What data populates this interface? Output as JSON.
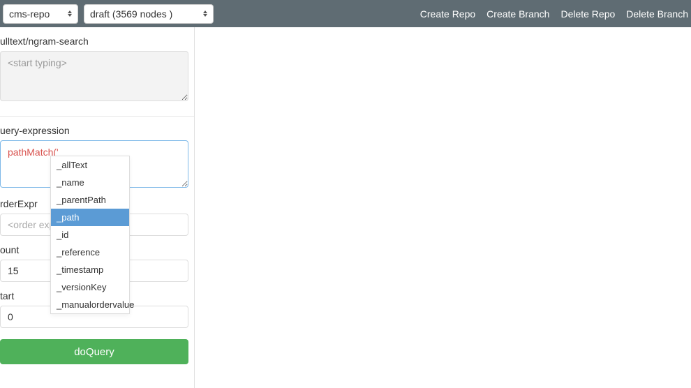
{
  "topbar": {
    "repo_select": "cms-repo",
    "branch_select": "draft (3569 nodes )",
    "actions": {
      "create_repo": "Create Repo",
      "create_branch": "Create Branch",
      "delete_repo": "Delete Repo",
      "delete_branch": "Delete Branch"
    }
  },
  "panel": {
    "fulltext_label": "ulltext/ngram-search",
    "fulltext_placeholder": "<start typing>",
    "query_label": "uery-expression",
    "query_value": "pathMatch('_",
    "order_label": "rderExpr",
    "order_placeholder": "<order expr>",
    "count_label": "ount",
    "count_value": "15",
    "start_label": "tart",
    "start_value": "0",
    "doquery_label": "doQuery"
  },
  "autocomplete": {
    "items": [
      "_allText",
      "_name",
      "_parentPath",
      "_path",
      "_id",
      "_reference",
      "_timestamp",
      "_versionKey",
      "_manualordervalue"
    ],
    "selected_index": 3
  }
}
